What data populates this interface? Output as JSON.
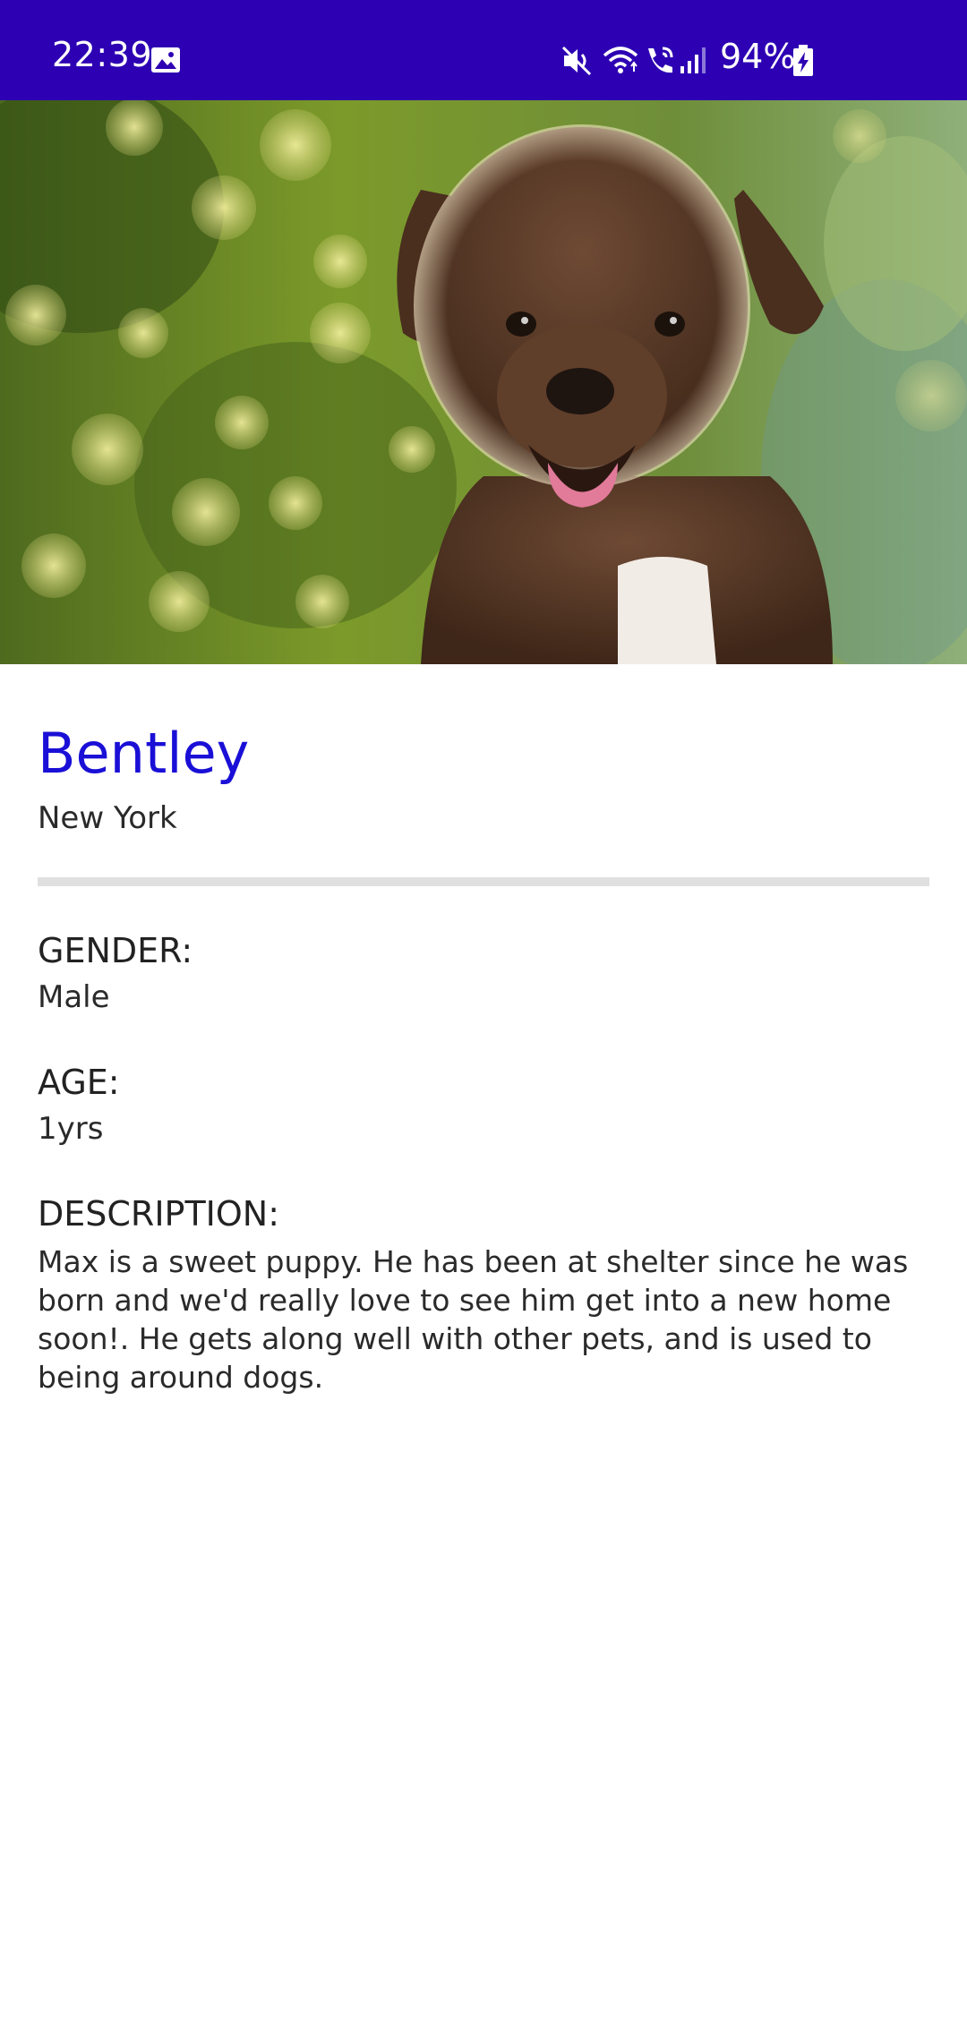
{
  "status_bar": {
    "time": "22:39",
    "battery": "94%",
    "icons": [
      "gallery-icon",
      "mute-icon",
      "wifi-icon",
      "call-icon",
      "signal-icon",
      "battery-charging-icon"
    ]
  },
  "hero": {
    "image": "puppy-photo",
    "colors": {
      "bokeh_green": "#7c9a2a",
      "fur_brown": "#5a3a28",
      "chest_white": "#f2ece6"
    }
  },
  "pet": {
    "name": "Bentley",
    "location": "New York",
    "gender_label": "GENDER:",
    "gender": "Male",
    "age_label": "AGE:",
    "age": "1yrs",
    "description_label": "DESCRIPTION:",
    "description": "Max is a sweet puppy. He has been at shelter since he was born and we'd really love to see him get into a new home soon!. He gets along well with other pets, and is used to being around dogs."
  },
  "colors": {
    "status_bar": "#2d00b3",
    "name_accent": "#1a0fd6",
    "divider": "#e0e0e0"
  }
}
